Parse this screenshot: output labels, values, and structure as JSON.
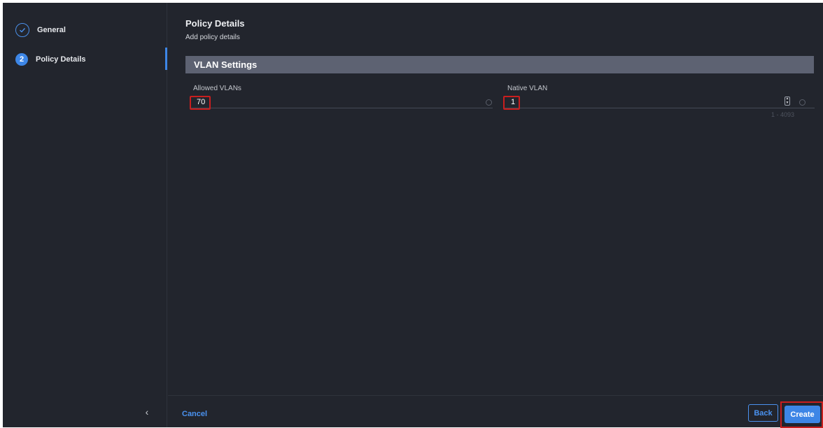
{
  "wizard": {
    "steps": [
      {
        "label": "General",
        "state": "done"
      },
      {
        "label": "Policy Details",
        "number": "2",
        "state": "active"
      }
    ],
    "collapse_icon": "chevron-left-icon"
  },
  "main": {
    "title": "Policy Details",
    "subtitle": "Add policy details",
    "section_title": "VLAN Settings",
    "fields": {
      "allowed_vlans": {
        "label": "Allowed VLANs",
        "value": "70"
      },
      "native_vlan": {
        "label": "Native VLAN",
        "value": "1",
        "range_hint": "1 - 4093"
      }
    }
  },
  "footer": {
    "cancel_label": "Cancel",
    "back_label": "Back",
    "create_label": "Create"
  },
  "colors": {
    "background": "#22252d",
    "accent": "#3d86e6",
    "section_header": "#5d6272",
    "highlight": "#c91e1e"
  }
}
